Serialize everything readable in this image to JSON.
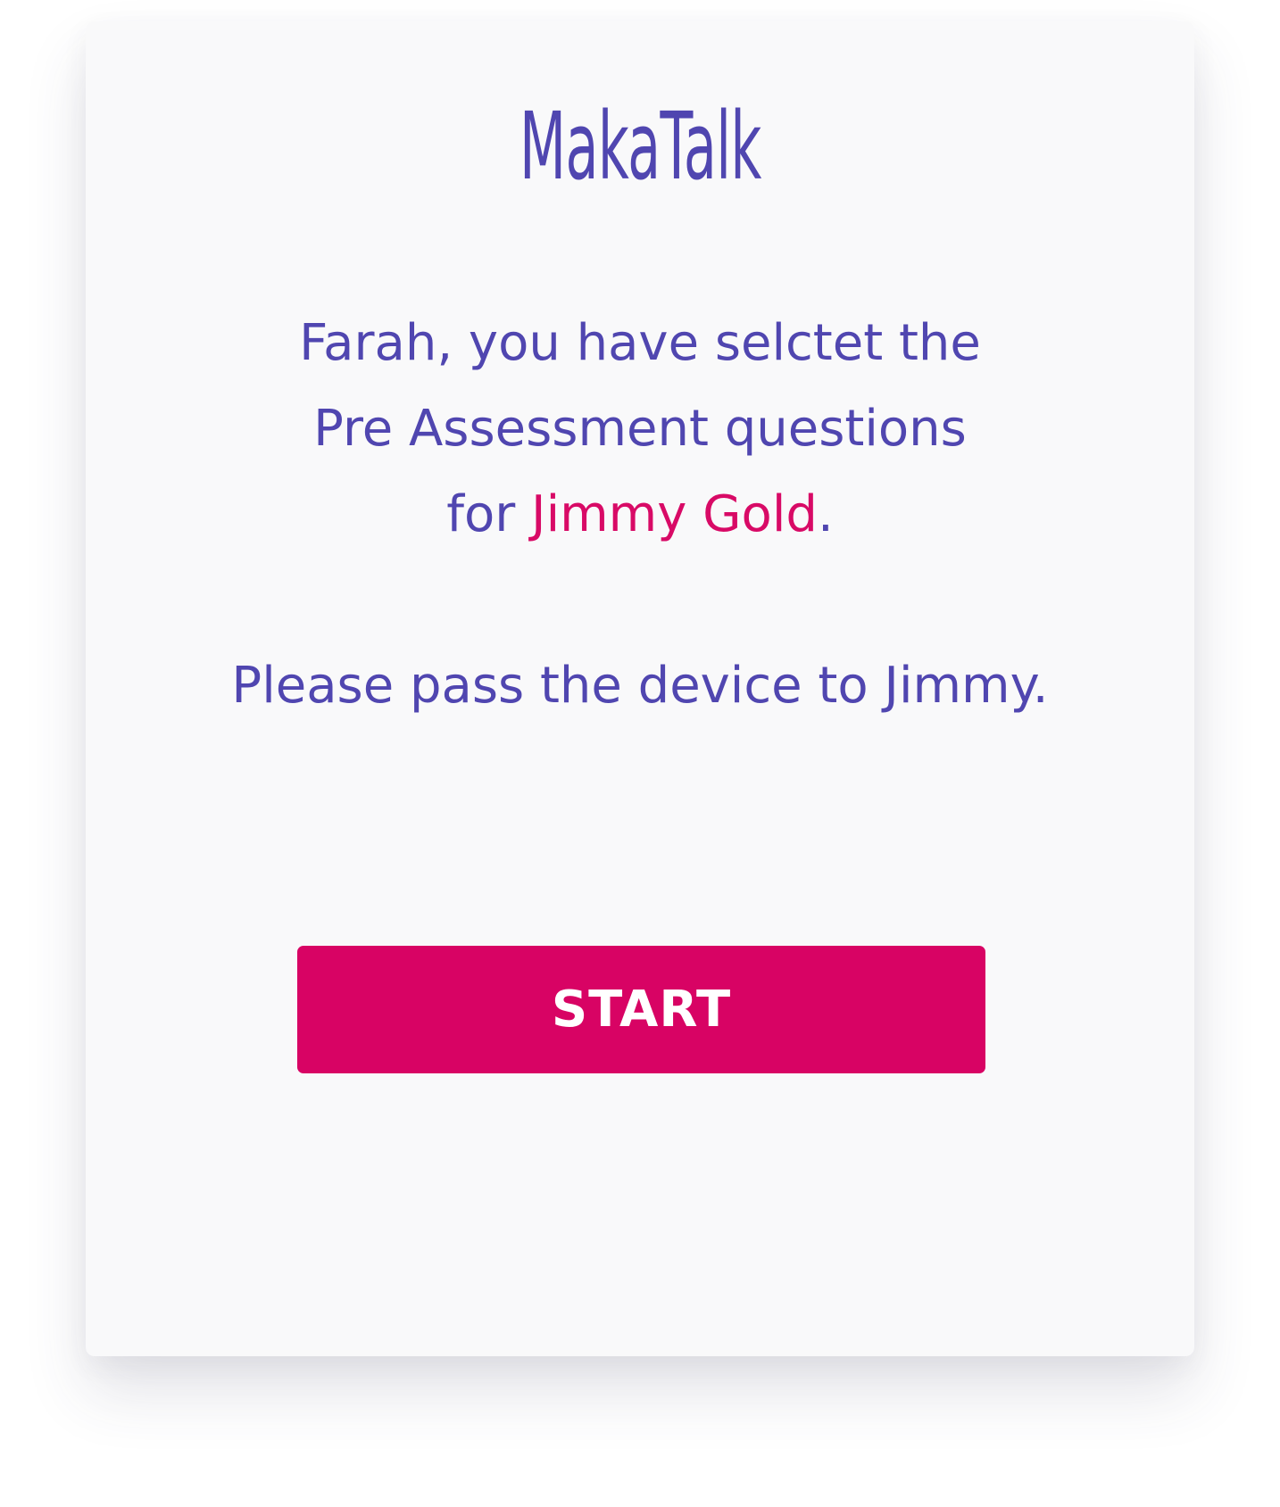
{
  "app": {
    "logo_text": "MakaTalk"
  },
  "message": {
    "intro": "Farah, you have selctet the Pre Assessment questions for",
    "student_name": "Jimmy Gold",
    "period": ".",
    "instruction": "Please pass the device to Jimmy."
  },
  "actions": {
    "start_label": "START"
  },
  "colors": {
    "primary_text": "#5046b0",
    "accent": "#d80364",
    "card_background": "#f9f9fa"
  }
}
